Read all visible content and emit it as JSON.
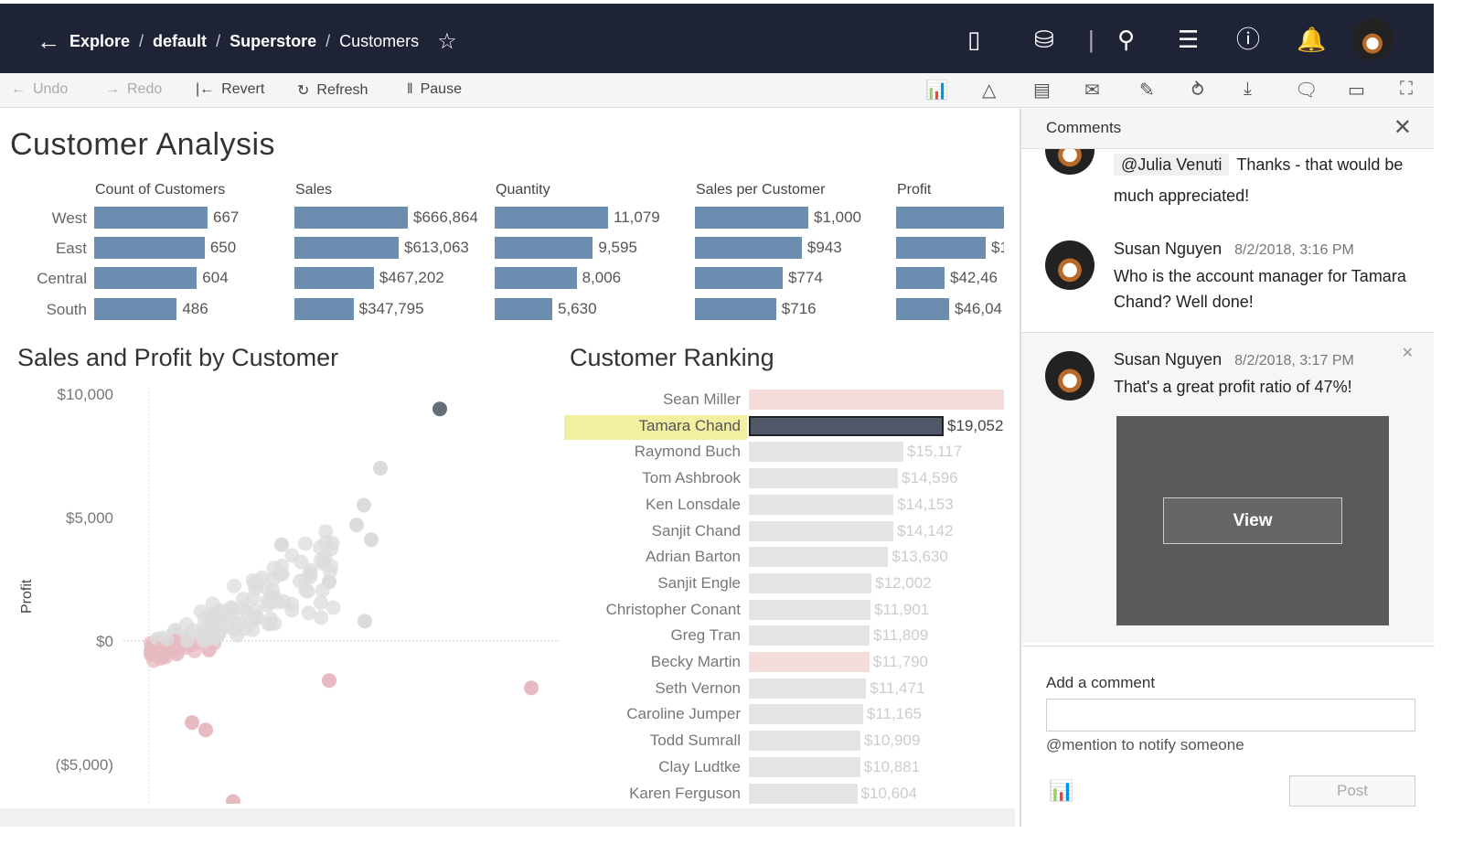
{
  "header": {
    "breadcrumb": [
      "Explore",
      "default",
      "Superstore",
      "Customers"
    ],
    "icons": [
      "back-arrow-icon",
      "star-icon",
      "device-preview-icon",
      "data-source-icon",
      "search-icon",
      "favorites-icon",
      "help-icon",
      "bell-icon",
      "avatar"
    ]
  },
  "toolbar": {
    "undo": "Undo",
    "redo": "Redo",
    "revert": "Revert",
    "refresh": "Refresh",
    "pause": "Pause",
    "right_icons": [
      "metrics-icon",
      "alert-icon",
      "watch-icon",
      "subscribe-icon",
      "edit-icon",
      "share-icon",
      "download-icon",
      "comments-icon",
      "view-icon",
      "fullscreen-icon"
    ]
  },
  "dashboard": {
    "title": "Customer Analysis",
    "kpis": {
      "regions": [
        "West",
        "East",
        "Central",
        "South"
      ],
      "columns": [
        {
          "header": "Count of Customers",
          "values": [
            667,
            650,
            604,
            486
          ],
          "labels": [
            "667",
            "650",
            "604",
            "486"
          ]
        },
        {
          "header": "Sales",
          "values": [
            666864,
            613063,
            467202,
            347795
          ],
          "labels": [
            "$666,864",
            "$613,063",
            "$467,202",
            "$347,795"
          ]
        },
        {
          "header": "Quantity",
          "values": [
            11079,
            9595,
            8006,
            5630
          ],
          "labels": [
            "11,079",
            "9,595",
            "8,006",
            "5,630"
          ]
        },
        {
          "header": "Sales per Customer",
          "values": [
            1000,
            943,
            774,
            716
          ],
          "labels": [
            "$1,000",
            "$943",
            "$774",
            "$716"
          ]
        },
        {
          "header": "Profit",
          "labels": [
            "",
            "$1",
            "$42,46",
            "$46,04"
          ]
        }
      ]
    },
    "scatter": {
      "title": "Sales and Profit by Customer",
      "ylabel": "Profit",
      "yticks": [
        "$10,000",
        "$5,000",
        "$0",
        "($5,000)"
      ]
    },
    "ranking": {
      "title": "Customer Ranking",
      "highlighted": "Tamara Chand",
      "items": [
        {
          "name": "Sean Miller",
          "value": 25043,
          "label": ""
        },
        {
          "name": "Tamara Chand",
          "value": 19052,
          "label": "$19,052"
        },
        {
          "name": "Raymond Buch",
          "value": 15117,
          "label": "$15,117"
        },
        {
          "name": "Tom Ashbrook",
          "value": 14596,
          "label": "$14,596"
        },
        {
          "name": "Ken Lonsdale",
          "value": 14153,
          "label": "$14,153"
        },
        {
          "name": "Sanjit Chand",
          "value": 14142,
          "label": "$14,142"
        },
        {
          "name": "Adrian Barton",
          "value": 13630,
          "label": "$13,630"
        },
        {
          "name": "Sanjit Engle",
          "value": 12002,
          "label": "$12,002"
        },
        {
          "name": "Christopher Conant",
          "value": 11901,
          "label": "$11,901"
        },
        {
          "name": "Greg Tran",
          "value": 11809,
          "label": "$11,809"
        },
        {
          "name": "Becky Martin",
          "value": 11790,
          "label": "$11,790"
        },
        {
          "name": "Seth Vernon",
          "value": 11471,
          "label": "$11,471"
        },
        {
          "name": "Caroline Jumper",
          "value": 11165,
          "label": "$11,165"
        },
        {
          "name": "Todd Sumrall",
          "value": 10909,
          "label": "$10,909"
        },
        {
          "name": "Clay Ludtke",
          "value": 10881,
          "label": "$10,881"
        },
        {
          "name": "Karen Ferguson",
          "value": 10604,
          "label": "$10,604"
        }
      ]
    }
  },
  "comments": {
    "title": "Comments",
    "items": [
      {
        "mention": "@Julia Venuti",
        "text": "Thanks - that would be much appreciated!"
      },
      {
        "author": "Susan Nguyen",
        "date": "8/2/2018, 3:16 PM",
        "text": "Who is the account manager for Tamara Chand? Well done!"
      },
      {
        "author": "Susan Nguyen",
        "date": "8/2/2018, 3:17 PM",
        "text": "That's a great profit ratio of 47%!",
        "snapshot_button": "View"
      }
    ],
    "add_label": "Add a comment",
    "input_value": "",
    "hint": "@mention to notify someone",
    "post": "Post"
  },
  "colors": {
    "header": "#1f2336",
    "bar": "#6a8db0",
    "highlight": "#f2f0a0",
    "selected_bar": "#4f5768"
  }
}
